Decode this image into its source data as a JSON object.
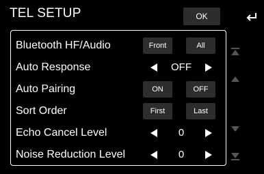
{
  "header": {
    "title": "TEL SETUP",
    "ok_label": "OK",
    "back_icon": "back-arrow-icon"
  },
  "settings": [
    {
      "label": "Bluetooth HF/Audio",
      "type": "choice",
      "options": [
        "Front",
        "All"
      ]
    },
    {
      "label": "Auto Response",
      "type": "stepper",
      "value": "OFF"
    },
    {
      "label": "Auto Pairing",
      "type": "choice",
      "options": [
        "ON",
        "OFF"
      ]
    },
    {
      "label": "Sort Order",
      "type": "choice",
      "options": [
        "First",
        "Last"
      ]
    },
    {
      "label": "Echo Cancel Level",
      "type": "stepper",
      "value": "0"
    },
    {
      "label": "Noise Reduction Level",
      "type": "stepper",
      "value": "0"
    }
  ],
  "scrollbar": {
    "icons": [
      "scroll-top-icon",
      "scroll-up-icon",
      "scroll-down-icon",
      "scroll-bottom-icon"
    ],
    "color": "#555555"
  },
  "colors": {
    "background": "#000000",
    "button": "#2d2d2d",
    "text": "#ffffff"
  }
}
